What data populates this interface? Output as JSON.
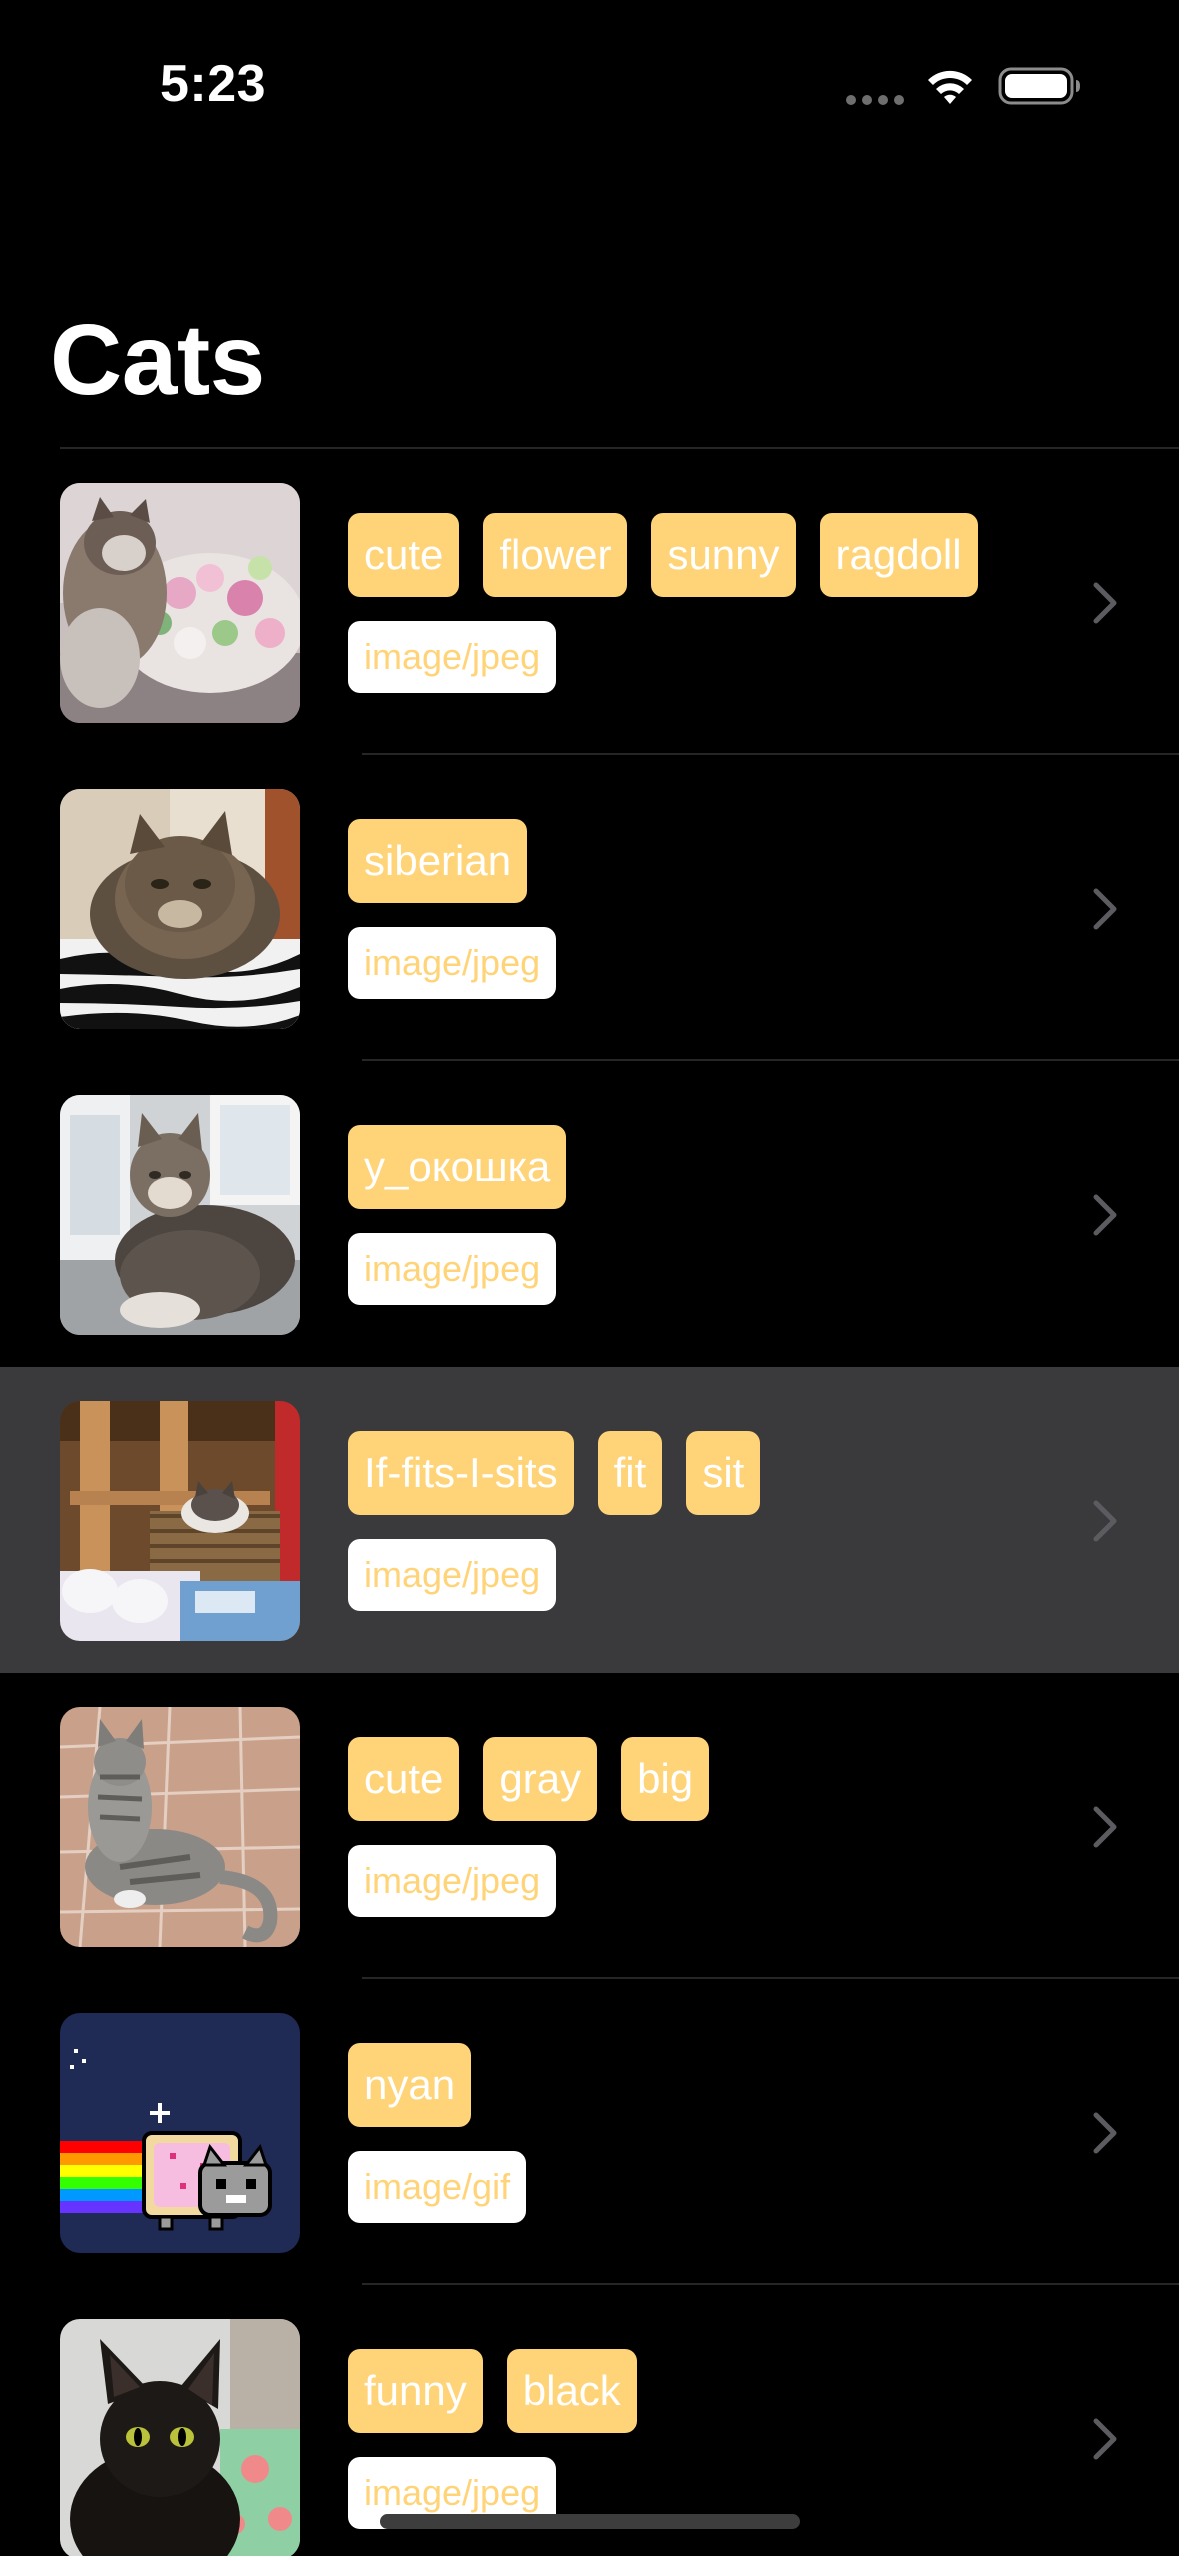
{
  "status_bar": {
    "time": "5:23"
  },
  "navigation": {
    "title": "Cats"
  },
  "colors": {
    "background": "#000000",
    "tag_background": "#ffd478",
    "tag_text": "#ffffff",
    "mime_background": "#ffffff",
    "mime_text": "#ffd478",
    "selected_row": "#3a3a3c"
  },
  "cats": [
    {
      "tags": [
        "cute",
        "flower",
        "sunny",
        "ragdoll"
      ],
      "mime": "image/jpeg",
      "thumbnail": "cat-with-flowers",
      "selected": false
    },
    {
      "tags": [
        "siberian"
      ],
      "mime": "image/jpeg",
      "thumbnail": "fluffy-cat-on-zebra-blanket",
      "selected": false
    },
    {
      "tags": [
        "у_окошка"
      ],
      "mime": "image/jpeg",
      "thumbnail": "cat-by-window",
      "selected": false
    },
    {
      "tags": [
        "If-fits-I-sits",
        "fit",
        "sit"
      ],
      "mime": "image/jpeg",
      "thumbnail": "cat-in-basket",
      "selected": true
    },
    {
      "tags": [
        "cute",
        "gray",
        "big"
      ],
      "mime": "image/jpeg",
      "thumbnail": "gray-tabby-on-tiles",
      "selected": false
    },
    {
      "tags": [
        "nyan"
      ],
      "mime": "image/gif",
      "thumbnail": "nyan-cat",
      "selected": false
    },
    {
      "tags": [
        "funny",
        "black"
      ],
      "mime": "image/jpeg",
      "thumbnail": "black-cat",
      "selected": false
    }
  ]
}
